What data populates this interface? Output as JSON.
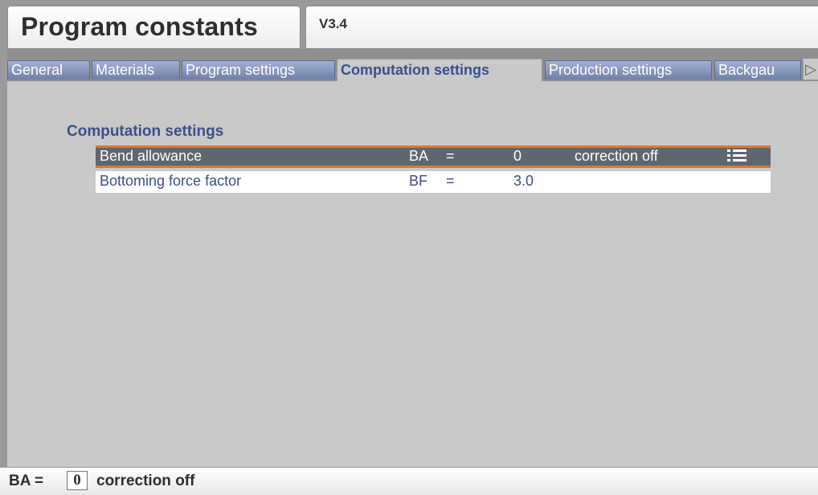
{
  "window": {
    "title": "Program constants",
    "version": "V3.4"
  },
  "tabs": [
    {
      "label": "General",
      "active": false
    },
    {
      "label": "Materials",
      "active": false
    },
    {
      "label": "Program settings",
      "active": false
    },
    {
      "label": "Computation settings",
      "active": true
    },
    {
      "label": "Production settings",
      "active": false
    },
    {
      "label": "Backgau",
      "active": false
    }
  ],
  "tab_scroll_icon": "triangle-right-icon",
  "section": {
    "title": "Computation settings",
    "rows": [
      {
        "label": "Bend allowance",
        "symbol": "BA",
        "eq": "=",
        "value": "0",
        "extra": "correction off",
        "icon": "list-icon",
        "selected": true
      },
      {
        "label": "Bottoming force factor",
        "symbol": "BF",
        "eq": "=",
        "value": "3.0",
        "extra": "",
        "selected": false
      }
    ]
  },
  "status": {
    "label": "BA =",
    "value": "0",
    "text": "correction off"
  },
  "colors": {
    "tab_bg": "#6e7fa9",
    "selected_row": "#5f6670",
    "selected_border": "#d97a2a",
    "accent_text": "#3a4f8c"
  }
}
